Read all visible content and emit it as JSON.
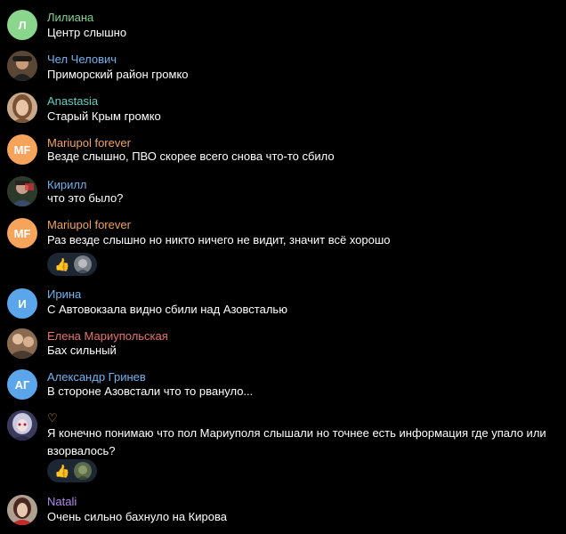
{
  "messages": [
    {
      "name": "Лилиана",
      "name_color": "#7ed491",
      "avatar_text": "Л",
      "avatar_color": "#8ad68c",
      "text": "Центр слышно"
    },
    {
      "name": "Чел Челович",
      "name_color": "#6fb3ee",
      "avatar_text": "",
      "avatar_color": "#4a3a2a",
      "text": "Приморский район громко"
    },
    {
      "name": "Anastasia",
      "name_color": "#5fd1c4",
      "avatar_text": "",
      "avatar_color": "#b8906a",
      "text": "Старый Крым громко"
    },
    {
      "name": "Mariupol forever",
      "name_color": "#f0a35a",
      "avatar_text": "MF",
      "avatar_color": "#f6a35c",
      "text": "Везде слышно, ПВО скорее всего снова что-то сбило"
    },
    {
      "name": "Кирилл",
      "name_color": "#6fb3ee",
      "avatar_text": "",
      "avatar_color": "#3a3a3a",
      "text": "что это было?"
    },
    {
      "name": "Mariupol forever",
      "name_color": "#f0a35a",
      "avatar_text": "MF",
      "avatar_color": "#f6a35c",
      "text": "Раз везде слышно но никто ничего не видит, значит всё хорошо",
      "reactions": {
        "emoji": "👍"
      }
    },
    {
      "name": "Ирина",
      "name_color": "#6fb3ee",
      "avatar_text": "И",
      "avatar_color": "#5ba6ea",
      "text": "С Автовокзала видно сбили  над Азовсталью"
    },
    {
      "name": "Елена Мариупольская",
      "name_color": "#e8726f",
      "avatar_text": "",
      "avatar_color": "#6a5040",
      "text": "Бах сильный"
    },
    {
      "name": "Александр Гринев",
      "name_color": "#6fb3ee",
      "avatar_text": "АГ",
      "avatar_color": "#5ba6ea",
      "text": "В стороне Азовстали что то рвануло..."
    },
    {
      "name": "♡",
      "name_color": "#f0a35a",
      "avatar_text": "",
      "avatar_color": "#4a4a6a",
      "text": "Я конечно понимаю что пол Мариуполя слышали но точнее есть информация где упало или взорвалось?",
      "reactions": {
        "emoji": "👍"
      }
    },
    {
      "name": "Natali",
      "name_color": "#b38aef",
      "avatar_text": "",
      "avatar_color": "#7a5a4a",
      "text": "Очень сильно бахнуло на Кирова"
    }
  ]
}
